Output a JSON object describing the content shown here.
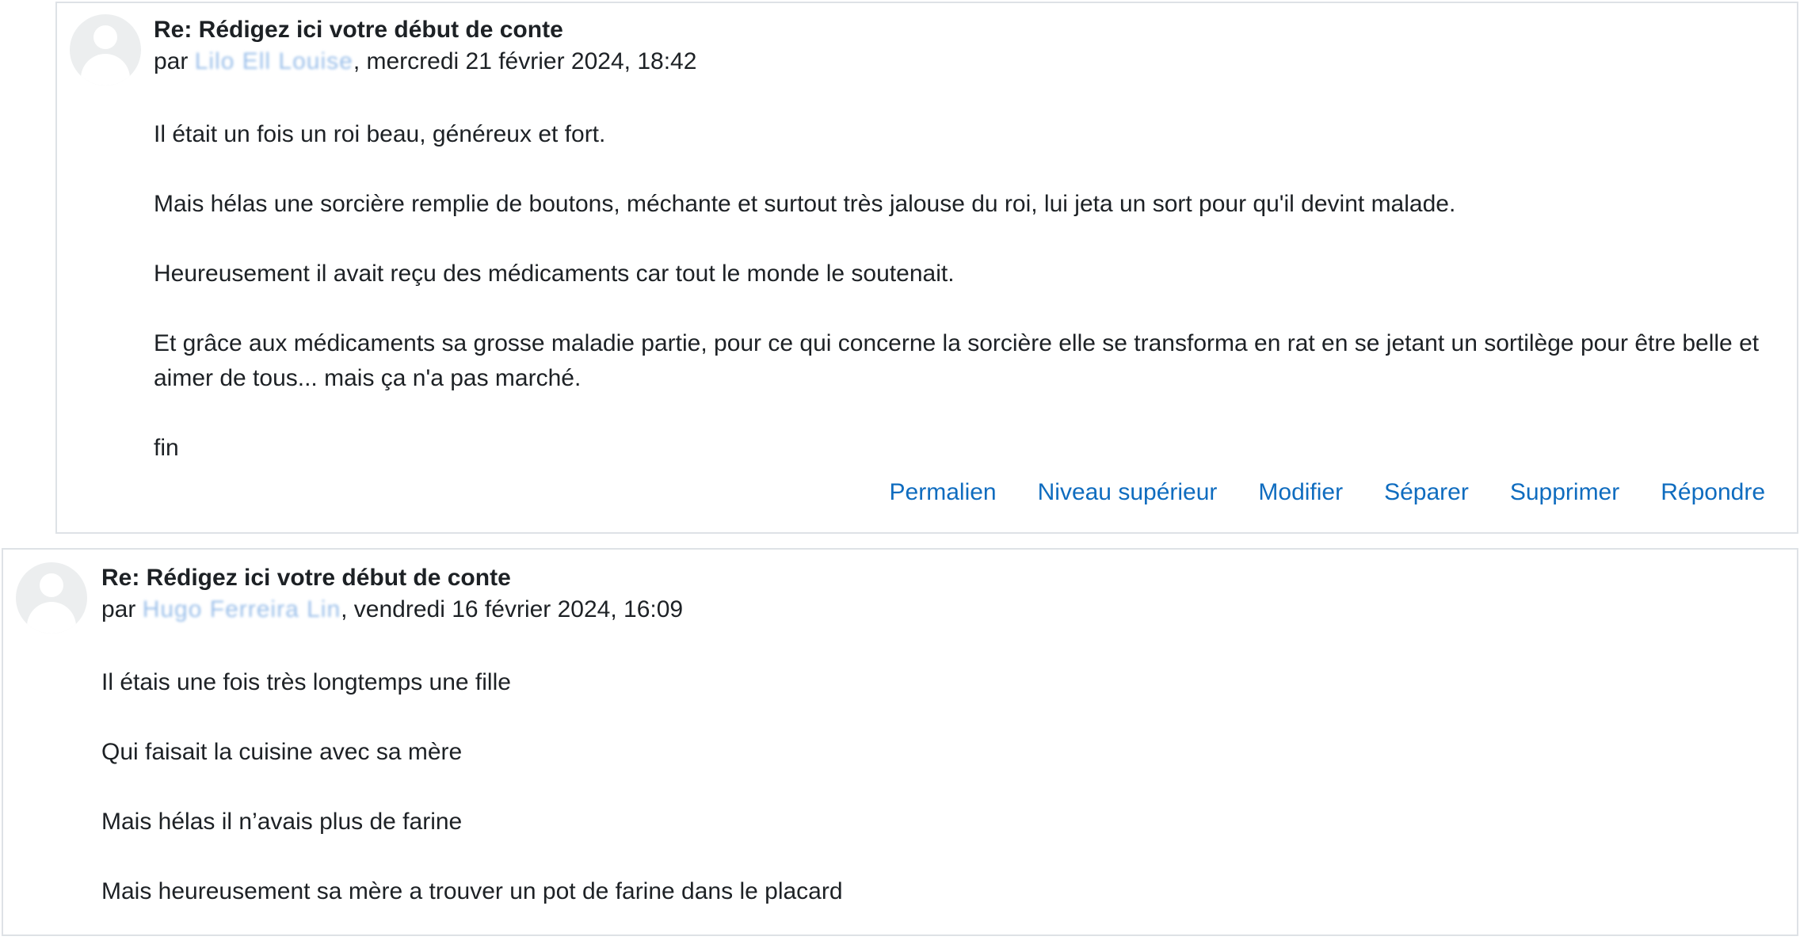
{
  "posts": [
    {
      "title": "Re: Rédigez ici votre début de conte",
      "by_prefix": "par",
      "author": "Lilo Ell Louise",
      "date": ", mercredi 21 février 2024, 18:42",
      "paragraphs": [
        "Il était un fois un roi beau, généreux et fort.",
        "Mais hélas une sorcière remplie de boutons, méchante et surtout très jalouse du roi, lui jeta un sort pour qu'il devint malade.",
        "Heureusement il avait reçu des médicaments car tout le monde le soutenait.",
        "Et grâce aux médicaments sa grosse maladie partie, pour ce qui concerne la sorcière elle se transforma en rat en se jetant un sortilège pour être belle et aimer de tous... mais ça n'a pas marché.",
        "fin"
      ],
      "actions": {
        "permalink": "Permalien",
        "parent": "Niveau supérieur",
        "edit": "Modifier",
        "split": "Séparer",
        "delete": "Supprimer",
        "reply": "Répondre"
      }
    },
    {
      "title": "Re: Rédigez ici votre début de conte",
      "by_prefix": "par",
      "author": "Hugo Ferreira Lin",
      "date": ", vendredi 16 février 2024, 16:09",
      "paragraphs": [
        "Il étais une fois très longtemps une fille",
        "Qui faisait la cuisine avec sa mère",
        "Mais hélas il n’avais plus de farine",
        "Mais heureusement sa mère a trouver un pot de farine dans le placard"
      ]
    }
  ]
}
